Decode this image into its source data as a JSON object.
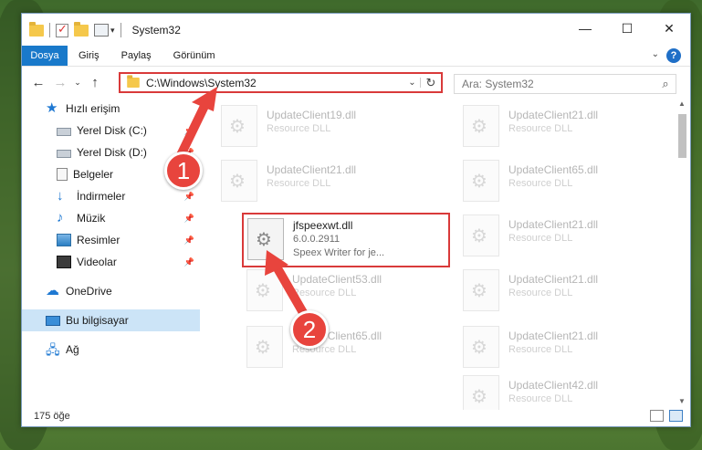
{
  "window": {
    "title": "System32",
    "controls": [
      "minimize-icon",
      "maximize-icon",
      "close-icon"
    ]
  },
  "ribbon": {
    "tabs": [
      "Dosya",
      "Giriş",
      "Paylaş",
      "Görünüm"
    ],
    "help_icon": "help-icon"
  },
  "address": {
    "path": "C:\\Windows\\System32",
    "search_placeholder": "Ara: System32"
  },
  "nav": {
    "quick_access": "Hızlı erişim",
    "items": [
      {
        "label": "Yerel Disk (C:)",
        "icon": "drive-icon",
        "pinned": true
      },
      {
        "label": "Yerel Disk (D:)",
        "icon": "drive-icon",
        "pinned": true
      },
      {
        "label": "Belgeler",
        "icon": "documents-icon",
        "pinned": true
      },
      {
        "label": "İndirmeler",
        "icon": "download-icon",
        "pinned": true
      },
      {
        "label": "Müzik",
        "icon": "music-icon",
        "pinned": true
      },
      {
        "label": "Resimler",
        "icon": "pictures-icon",
        "pinned": true
      },
      {
        "label": "Videolar",
        "icon": "videos-icon",
        "pinned": true
      }
    ],
    "onedrive": "OneDrive",
    "this_pc": "Bu bilgisayar",
    "network": "Ağ"
  },
  "files": {
    "left": [
      {
        "name": "UpdateClient19.dll",
        "desc": "Resource DLL"
      },
      {
        "name": "UpdateClient21.dll",
        "desc": "Resource DLL"
      },
      {
        "name": "UpdateClient53.dll",
        "desc": "Resource DLL"
      },
      {
        "name": "UpdateClient65.dll",
        "desc": "Resource DLL"
      }
    ],
    "right": [
      {
        "name": "UpdateClient21.dll",
        "desc": "Resource DLL"
      },
      {
        "name": "UpdateClient65.dll",
        "desc": "Resource DLL"
      },
      {
        "name": "UpdateClient21.dll",
        "desc": "Resource DLL"
      },
      {
        "name": "UpdateClient21.dll",
        "desc": "Resource DLL"
      },
      {
        "name": "UpdateClient21.dll",
        "desc": "Resource DLL"
      },
      {
        "name": "UpdateClient42.dll",
        "desc": "Resource DLL"
      }
    ],
    "highlighted": {
      "name": "jfspeexwt.dll",
      "version": "6.0.0.2911",
      "desc": "Speex Writer for je..."
    }
  },
  "status": {
    "count": "175 öğe"
  },
  "annotations": {
    "badge1": "1",
    "badge2": "2",
    "color": "#e8443d"
  }
}
